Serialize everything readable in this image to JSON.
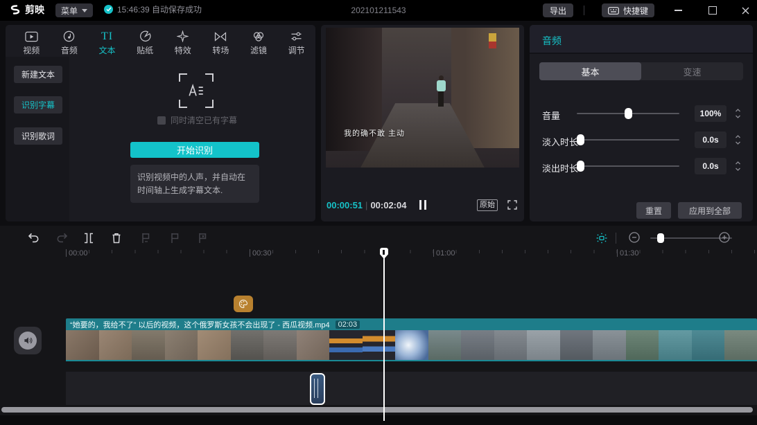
{
  "app": {
    "logo_text": "剪映",
    "menu_label": "菜单",
    "autosave_text": "15:46:39 自动保存成功",
    "project_title": "202101211543",
    "export_label": "导出",
    "shortcuts_label": "快捷键"
  },
  "media_tabs": [
    {
      "label": "视频"
    },
    {
      "label": "音频"
    },
    {
      "label": "文本",
      "icon_text": "TI",
      "active": true
    },
    {
      "label": "贴纸"
    },
    {
      "label": "特效"
    },
    {
      "label": "转场"
    },
    {
      "label": "滤镜"
    },
    {
      "label": "调节"
    }
  ],
  "text_panel": {
    "sidebar": [
      {
        "label": "新建文本"
      },
      {
        "label": "识别字幕",
        "active": true
      },
      {
        "label": "识别歌词"
      }
    ],
    "checkbox_label": "同时清空已有字幕",
    "start_button_label": "开始识别",
    "description": "识别视频中的人声，并自动在时间轴上生成字幕文本."
  },
  "preview": {
    "subtitle": "我的确不敢 主动",
    "current_time": "00:00:51",
    "time_separator": "|",
    "total_time": "00:02:04",
    "original_label": "原始"
  },
  "audio_panel": {
    "title": "音频",
    "tabs": [
      {
        "label": "基本",
        "active": true
      },
      {
        "label": "变速"
      }
    ],
    "rows": [
      {
        "label": "音量",
        "value": "100%",
        "slider_percent": 50
      },
      {
        "label": "淡入时长",
        "value": "0.0s",
        "slider_percent": 0
      },
      {
        "label": "淡出时长",
        "value": "0.0s",
        "slider_percent": 0
      }
    ],
    "reset_label": "重置",
    "apply_all_label": "应用到全部"
  },
  "timeline": {
    "ruler_labels": [
      "00:00",
      "00:30",
      "01:00",
      "01:30"
    ],
    "clip_title": "“她要的，我给不了” 以后的视频，这个俄罗斯女孩不会出现了 - 西瓜视频.mp4",
    "clip_duration": "02:03"
  },
  "colors": {
    "accent": "#16c2c8",
    "clip_header": "#1e7d8a",
    "marker_orange": "#b8812f",
    "panel_bg": "#1b1b21"
  }
}
